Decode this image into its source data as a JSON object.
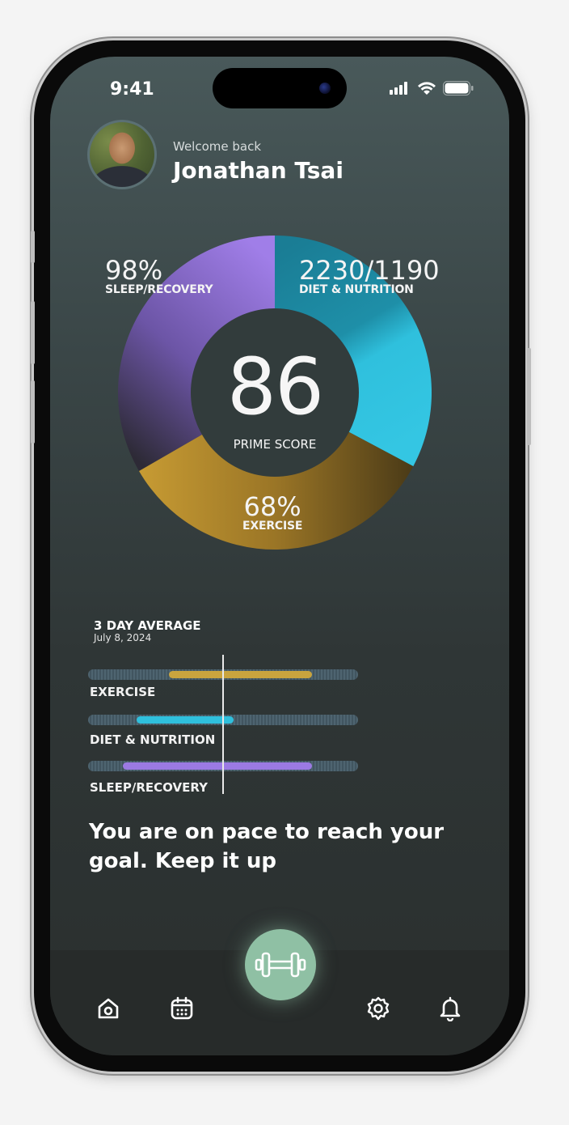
{
  "status": {
    "time": "9:41"
  },
  "header": {
    "welcome": "Welcome back",
    "name": "Jonathan Tsai"
  },
  "score": {
    "value": "86",
    "label": "PRIME SCORE",
    "segments": [
      {
        "name": "SLEEP/RECOVERY",
        "value": "98%",
        "color": "#9b7ae3"
      },
      {
        "name": "DIET & NUTRITION",
        "value": "2230/1190",
        "color": "#2fc0dd"
      },
      {
        "name": "EXERCISE",
        "value": "68%",
        "color": "#c9a43e"
      }
    ]
  },
  "average": {
    "title": "3 DAY AVERAGE",
    "date": "July 8, 2024",
    "bars": [
      {
        "label": "EXERCISE",
        "start": 0.3,
        "end": 0.83,
        "color": "#c9a43e"
      },
      {
        "label": "DIET & NUTRITION",
        "start": 0.18,
        "end": 0.54,
        "color": "#2fc0dd"
      },
      {
        "label": "SLEEP/RECOVERY",
        "start": 0.13,
        "end": 0.83,
        "color": "#9b7ae3"
      }
    ]
  },
  "message": "You are on pace to reach your goal. Keep it up",
  "tabbar": {
    "items": [
      "home-icon",
      "calendar-icon",
      "dumbbell-icon",
      "gear-icon",
      "bell-icon"
    ]
  }
}
